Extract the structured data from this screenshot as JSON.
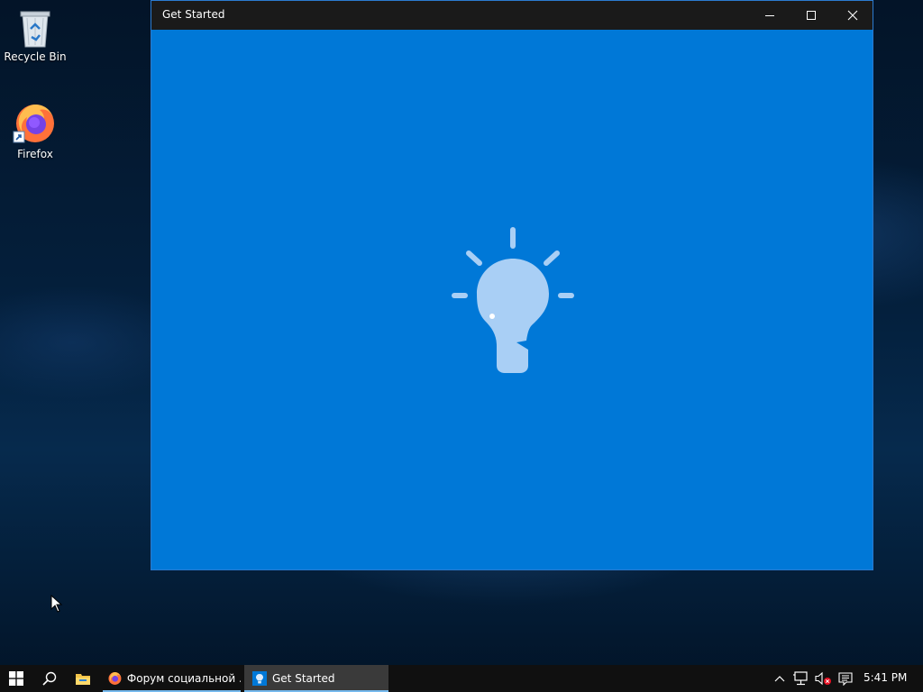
{
  "desktop": {
    "icons": [
      {
        "label": "Recycle Bin",
        "icon": "recycle-bin-icon"
      },
      {
        "label": "Firefox",
        "icon": "firefox-icon"
      }
    ]
  },
  "window": {
    "title": "Get Started",
    "controls": [
      "minimize",
      "maximize",
      "close"
    ],
    "content_icon": "lightbulb-icon",
    "background_color": "#0078d7"
  },
  "taskbar": {
    "start_icon": "windows-start-icon",
    "search_icon": "search-icon",
    "explorer_icon": "file-explorer-icon",
    "apps": [
      {
        "label": "Форум социальной ...",
        "icon": "firefox-icon",
        "active": false
      },
      {
        "label": "Get Started",
        "icon": "get-started-icon",
        "active": true
      }
    ],
    "tray": {
      "icons": [
        "chevron-up-icon",
        "network-icon",
        "volume-muted-icon",
        "notifications-icon"
      ],
      "time": "5:41 PM"
    }
  }
}
